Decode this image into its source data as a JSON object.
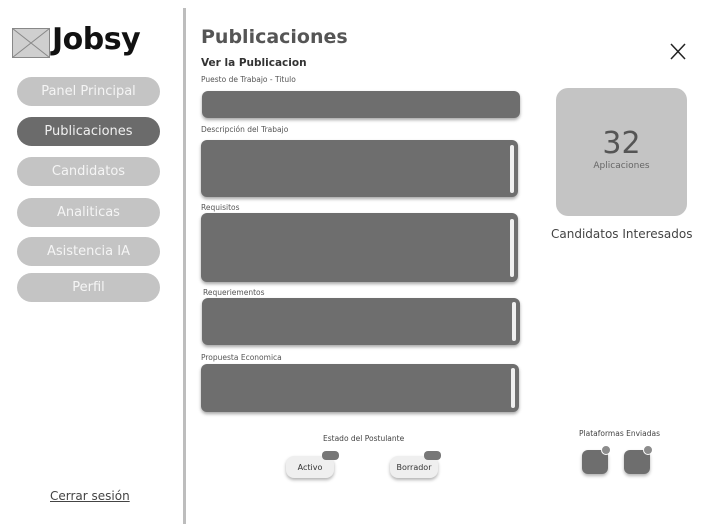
{
  "brand": {
    "name": "Jobsy"
  },
  "sidebar": {
    "items": [
      {
        "label": "Panel Principal",
        "active": false
      },
      {
        "label": "Publicaciones",
        "active": true
      },
      {
        "label": "Candidatos",
        "active": false
      },
      {
        "label": "Analiticas",
        "active": false
      },
      {
        "label": "Asistencia IA",
        "active": false
      },
      {
        "label": "Perfil",
        "active": false
      }
    ],
    "logout_label": "Cerrar sesión"
  },
  "main": {
    "title": "Publicaciones",
    "subtitle": "Ver la Publicacion",
    "fields": [
      {
        "label": "Puesto de Trabajo - Titulo"
      },
      {
        "label": "Descripción del Trabajo"
      },
      {
        "label": "Requisitos"
      },
      {
        "label": "Requeriementos"
      },
      {
        "label": "Propuesta Economica"
      }
    ],
    "status": {
      "label": "Estado del Postulante",
      "options": [
        "Activo",
        "Borrador"
      ]
    },
    "platforms": {
      "label": "Plataformas Enviadas"
    }
  },
  "stats": {
    "count": "32",
    "caption": "Aplicaciones",
    "interested_label": "Candidatos Interesados"
  },
  "icons": {
    "logo": "image-placeholder-icon",
    "close": "close-icon"
  },
  "colors": {
    "active_nav": "#6b6b6b",
    "inactive_nav": "#c4c4c4",
    "field": "#6e6e6e"
  }
}
